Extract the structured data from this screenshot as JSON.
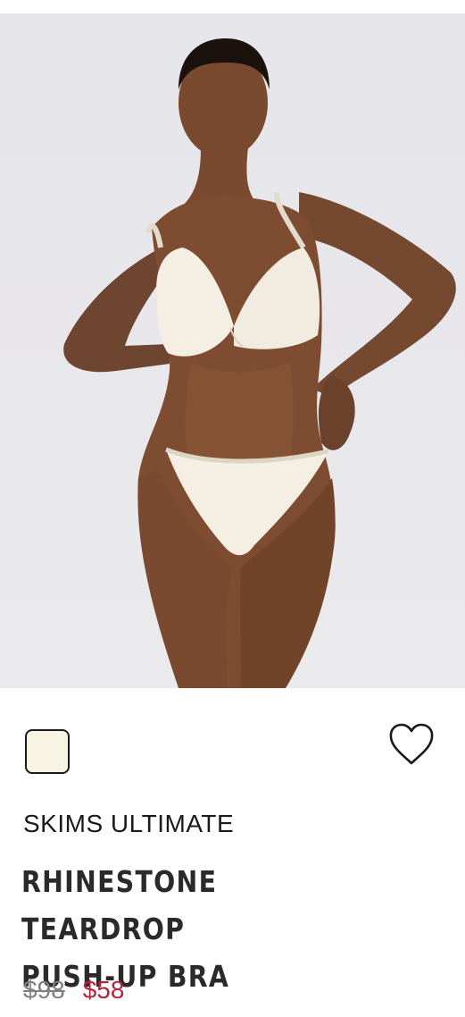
{
  "product": {
    "image_alt": "Model wearing ivory rhinestone teardrop push-up bra and matching thong",
    "swatch": {
      "color": "#f8f4e4",
      "selected": true
    },
    "wishlist_icon": "heart-outline-icon",
    "brand": "SKIMS ULTIMATE",
    "name_line1": "RHINESTONE TEARDROP",
    "name_line2": "PUSH-UP BRA",
    "price_original": "$98",
    "price_sale": "$58"
  },
  "colors": {
    "sale": "#b0243c",
    "original": "#808080",
    "text": "#1a1a1a",
    "image_bg": "#e7e6ea",
    "garment": "#f4efe2"
  }
}
